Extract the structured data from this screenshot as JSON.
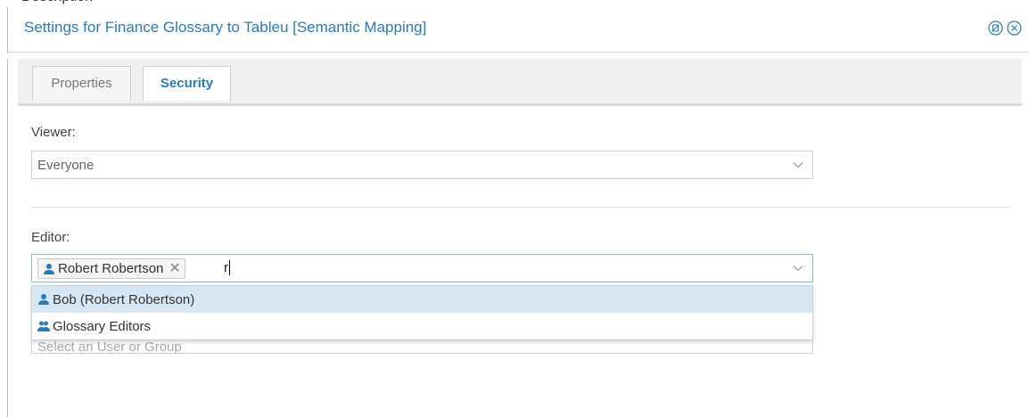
{
  "dialog": {
    "title": "Settings for Finance Glossary to Tableu [Semantic Mapping]"
  },
  "tabs": [
    {
      "label": "Properties",
      "active": false
    },
    {
      "label": "Security",
      "active": true
    }
  ],
  "viewer": {
    "label": "Viewer:",
    "value": "Everyone"
  },
  "editor": {
    "label": "Editor:",
    "selected_tag": "Robert Robertson",
    "typed_text": "r",
    "options": [
      {
        "label": "Bob (Robert Robertson)",
        "icon": "user-icon",
        "highlighted": true
      },
      {
        "label": "Glossary Editors",
        "icon": "group-icon",
        "highlighted": false
      }
    ]
  },
  "third_field": {
    "placeholder": "Select an User or Group"
  },
  "colors": {
    "accent": "#2a7ab8",
    "highlight": "#d5e7f5"
  }
}
